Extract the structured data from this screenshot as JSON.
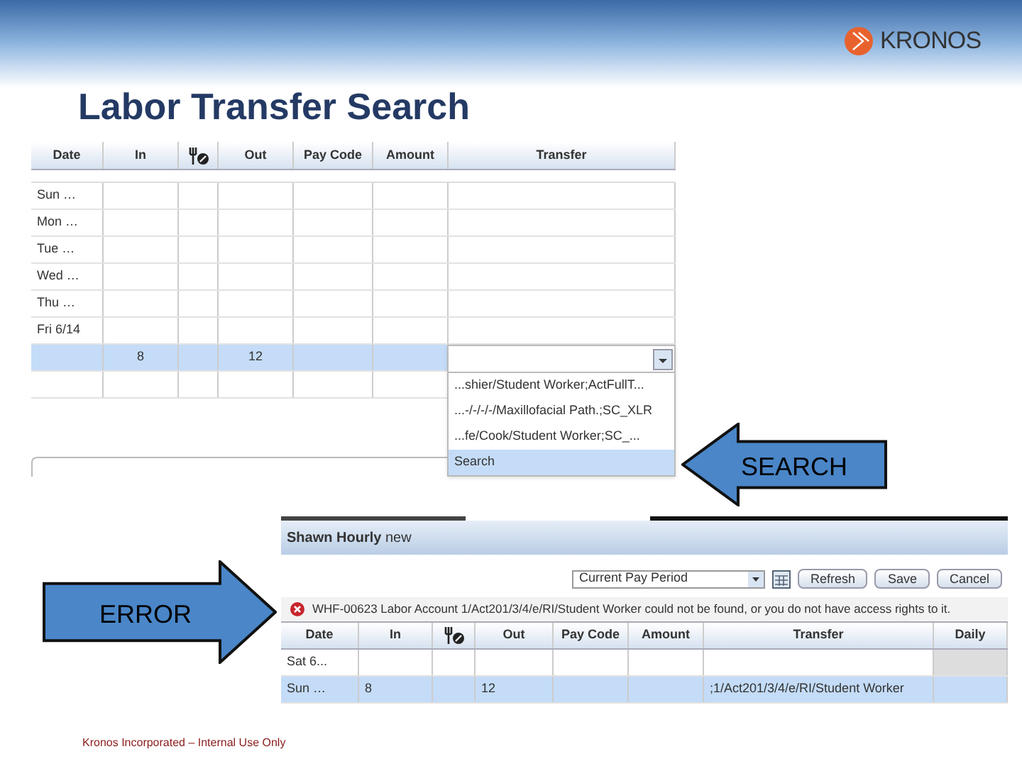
{
  "slide": {
    "title": "Labor Transfer Search",
    "logo_text": "KRONOS",
    "footer": "Kronos Incorporated – Internal Use Only"
  },
  "top_table": {
    "columns": [
      "Date",
      "In",
      "",
      "Out",
      "Pay Code",
      "Amount",
      "Transfer"
    ],
    "rows": [
      {
        "cells": [
          "Sun …",
          "",
          "",
          "",
          "",
          "",
          ""
        ],
        "selected": false
      },
      {
        "cells": [
          "Mon …",
          "",
          "",
          "",
          "",
          "",
          ""
        ],
        "selected": false
      },
      {
        "cells": [
          "Tue …",
          "",
          "",
          "",
          "",
          "",
          ""
        ],
        "selected": false
      },
      {
        "cells": [
          "Wed …",
          "",
          "",
          "",
          "",
          "",
          ""
        ],
        "selected": false
      },
      {
        "cells": [
          "Thu …",
          "",
          "",
          "",
          "",
          "",
          ""
        ],
        "selected": false
      },
      {
        "cells": [
          "Fri 6/14",
          "",
          "",
          "",
          "",
          "",
          ""
        ],
        "selected": false
      },
      {
        "cells": [
          "",
          "8",
          "",
          "12",
          "",
          "",
          ""
        ],
        "selected": true
      },
      {
        "cells": [
          "",
          "",
          "",
          "",
          "",
          "",
          ""
        ],
        "selected": false
      }
    ]
  },
  "transfer_dropdown": {
    "options": [
      {
        "label": "...shier/Student Worker;ActFullT...",
        "selected": false
      },
      {
        "label": "...-/-/-/-/Maxillofacial Path.;SC_XLR",
        "selected": false
      },
      {
        "label": "...fe/Cook/Student Worker;SC_...",
        "selected": false
      },
      {
        "label": "Search",
        "selected": true
      }
    ]
  },
  "search_callout": {
    "label": "SEARCH"
  },
  "error_callout": {
    "label": "ERROR"
  },
  "timecard": {
    "title": "**Shawn Hourly** new",
    "period": "Current Pay Period",
    "buttons": [
      "Refresh",
      "Save",
      "Cancel"
    ],
    "error": "WHF-00623 Labor Account 1/Act201/3/4/e/RI/Student Worker could not be found, or you do not have access rights to it.",
    "columns": [
      "Date",
      "In",
      "",
      "Out",
      "Pay Code",
      "Amount",
      "Transfer",
      "Daily"
    ],
    "rows": [
      {
        "cells": [
          "Sat 6...",
          "",
          "",
          "",
          "",
          "",
          "",
          ""
        ],
        "selected": false
      },
      {
        "cells": [
          "Sun …",
          "8",
          "",
          "12",
          "",
          "",
          ";1/Act201/3/4/e/RI/Student Worker",
          ""
        ],
        "selected": true
      }
    ]
  }
}
